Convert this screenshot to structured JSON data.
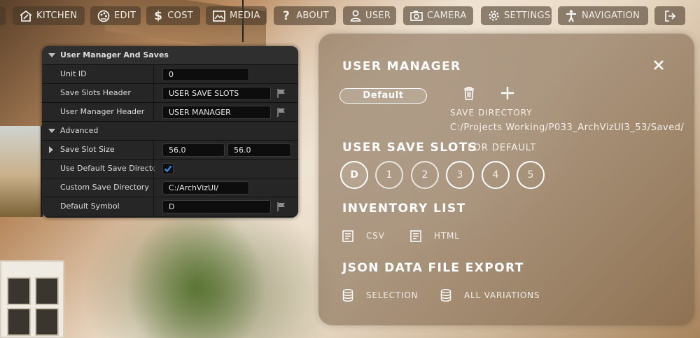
{
  "topnav": {
    "items": [
      {
        "label": "",
        "icon": "partial-icon"
      },
      {
        "label": "KITCHEN",
        "icon": "kitchen-icon"
      },
      {
        "label": "EDIT",
        "icon": "palette-icon"
      },
      {
        "label": "COST",
        "icon": "dollar-icon"
      },
      {
        "label": "MEDIA",
        "icon": "image-icon"
      },
      {
        "label": "ABOUT",
        "icon": "question-icon"
      },
      {
        "label": "USER",
        "icon": "user-icon"
      },
      {
        "label": "CAMERA",
        "icon": "camera-icon"
      },
      {
        "label": "SETTINGS",
        "icon": "gear-icon"
      },
      {
        "label": "NAVIGATION",
        "icon": "person-icon"
      },
      {
        "label": "",
        "icon": "logout-icon"
      }
    ]
  },
  "props": {
    "category": "User Manager And Saves",
    "unit_id_label": "Unit ID",
    "unit_id_value": "0",
    "save_slots_header_label": "Save Slots Header",
    "save_slots_header_value": "USER SAVE SLOTS",
    "user_manager_header_label": "User Manager Header",
    "user_manager_header_value": "USER MANAGER",
    "advanced_label": "Advanced",
    "save_slot_size_label": "Save Slot Size",
    "save_slot_size_x": "56.0",
    "save_slot_size_y": "56.0",
    "use_default_dir_label": "Use Default Save Directo...",
    "use_default_dir_checked": true,
    "custom_dir_label": "Custom Save Directory",
    "custom_dir_value": "C:/ArchVizUI/",
    "default_symbol_label": "Default Symbol",
    "default_symbol_value": "D"
  },
  "user_manager": {
    "title": "USER MANAGER",
    "profile": "Default",
    "save_directory_label": "SAVE DIRECTORY",
    "save_directory_path": "C:/Projects Working/P033_ArchVizUI3_53/Saved/",
    "save_slots_title": "USER SAVE SLOTS",
    "save_slots_for": "FOR DEFAULT",
    "slots": [
      "D",
      "1",
      "2",
      "3",
      "4",
      "5"
    ],
    "inventory_title": "INVENTORY LIST",
    "csv_label": "CSV",
    "html_label": "HTML",
    "json_title": "JSON DATA FILE EXPORT",
    "selection_label": "SELECTION",
    "all_variations_label": "ALL VARIATIONS"
  },
  "colors": {
    "accent_check": "#2f8fff",
    "panel_bg": "#1b1b1b"
  }
}
